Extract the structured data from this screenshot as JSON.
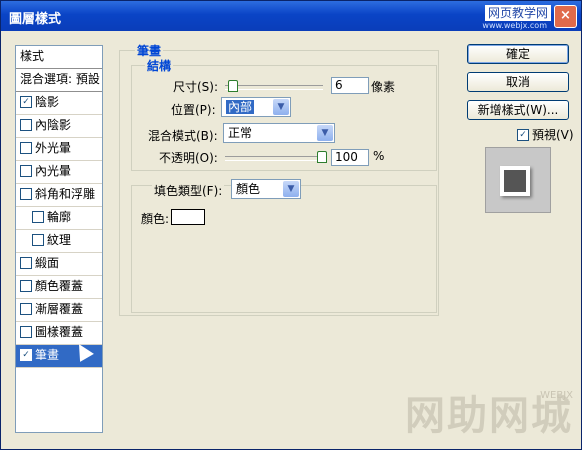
{
  "window": {
    "title": "圖層樣式",
    "close": "×"
  },
  "watermarks": {
    "top": "网页教学网",
    "top_url": "www.webjx.com",
    "bottom": "网助网城",
    "bottom_url": "WEBJX"
  },
  "sidebar": {
    "header": "樣式",
    "blend_options": "混合選項: 預設",
    "items": [
      {
        "label": "陰影",
        "checked": true
      },
      {
        "label": "內陰影",
        "checked": false
      },
      {
        "label": "外光暈",
        "checked": false
      },
      {
        "label": "內光暈",
        "checked": false
      },
      {
        "label": "斜角和浮雕",
        "checked": false
      },
      {
        "label": "輪廓",
        "checked": false,
        "indent": true
      },
      {
        "label": "紋理",
        "checked": false,
        "indent": true
      },
      {
        "label": "緞面",
        "checked": false
      },
      {
        "label": "顏色覆蓋",
        "checked": false
      },
      {
        "label": "漸層覆蓋",
        "checked": false
      },
      {
        "label": "圖樣覆蓋",
        "checked": false
      },
      {
        "label": "筆畫",
        "checked": true,
        "selected": true
      }
    ]
  },
  "stroke": {
    "group_title": "筆畫",
    "structure_title": "結構",
    "size_label": "尺寸(S):",
    "size_value": "6",
    "size_unit": "像素",
    "size_fraction": 0.03,
    "position_label": "位置(P):",
    "position_value": "內部",
    "blend_label": "混合模式(B):",
    "blend_value": "正常",
    "opacity_label": "不透明(O):",
    "opacity_value": "100",
    "opacity_unit": "%",
    "opacity_fraction": 1.0,
    "fill_type_label": "填色類型(F):",
    "fill_type_value": "顏色",
    "color_label": "顏色:",
    "color_value": "#ffffff"
  },
  "buttons": {
    "ok": "確定",
    "cancel": "取消",
    "new_style": "新增樣式(W)...",
    "preview": "預視(V)",
    "preview_checked": true
  }
}
